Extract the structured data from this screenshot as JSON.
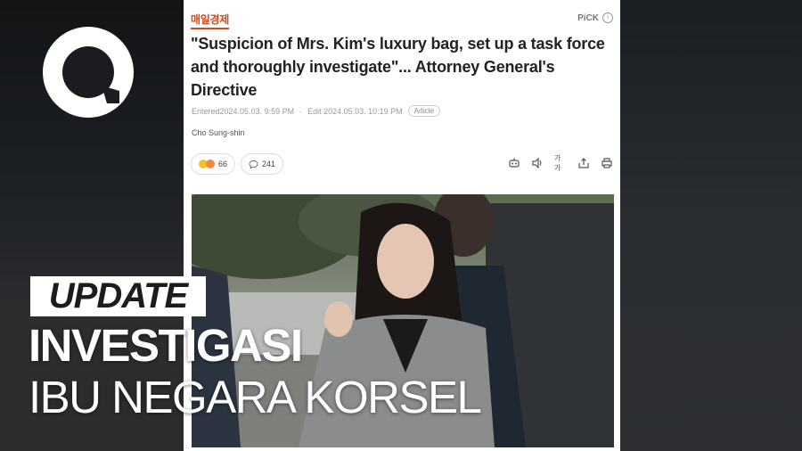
{
  "article": {
    "source": "매일경제",
    "pick_label": "PiCK",
    "headline": "\"Suspicion of Mrs. Kim's luxury bag, set up a task force and thoroughly investigate\"... Attorney General's Directive",
    "entered": "Entered2024.05.03. 9:59 PM",
    "edited": "Edit 2024.05.03. 10:19 PM",
    "badge": "Article",
    "author": "Cho Sung-shin",
    "reaction_count": "66",
    "comment_count": "241",
    "text_size_label": "가가"
  },
  "overlay": {
    "tag": "UPDATE",
    "title_line1": "INVESTIGASI",
    "title_line2": "IBU NEGARA KORSEL"
  },
  "colors": {
    "source_accent": "#d14a1e",
    "background": "#1a1c1f",
    "overlay_text": "#ffffff"
  },
  "icons": {
    "logo": "speech-bubble-logo",
    "tools": [
      "robot-summary-icon",
      "speaker-icon",
      "text-size-icon",
      "share-icon",
      "print-icon"
    ]
  }
}
